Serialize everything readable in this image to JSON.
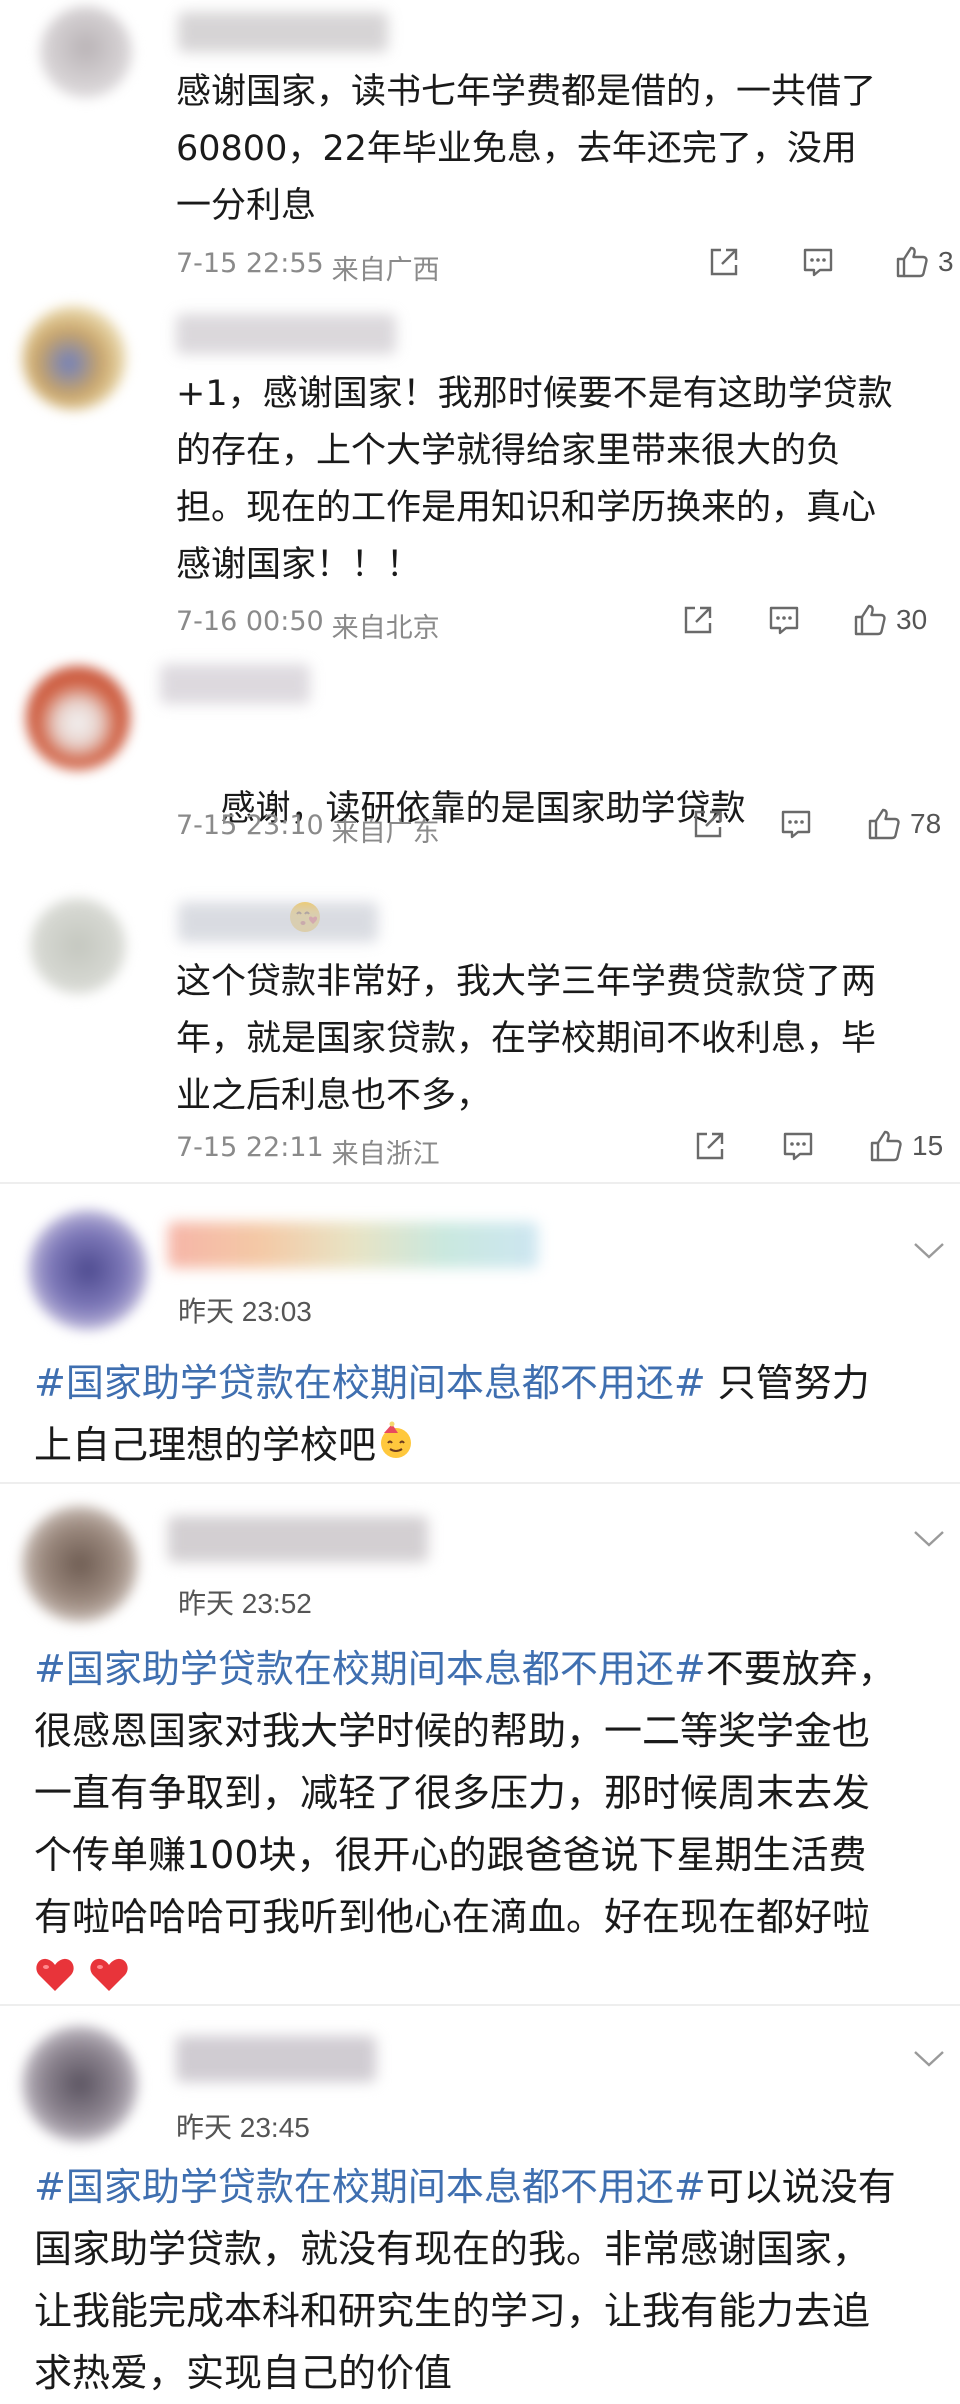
{
  "comments": [
    {
      "text": "感谢国家，读书七年学费都是借的，一共借了\n60800，22年毕业免息，去年还完了，没用\n一分利息",
      "date": "7-15 22:55",
      "location": "来自广西",
      "likes": "3"
    },
    {
      "text": "+1，感谢国家！我那时候要不是有这助学贷款\n的存在，上个大学就得给家里带来很大的负\n担。现在的工作是用知识和学历换来的，真心\n感谢国家！！！",
      "date": "7-16 00:50",
      "location": "来自北京",
      "likes": "30"
    },
    {
      "text": "感谢，读研依靠的是国家助学贷款",
      "date": "7-15 23:10",
      "location": "来自广东",
      "likes": "78",
      "emoji": "kiss-heart-emoji"
    },
    {
      "text": "这个贷款非常好，我大学三年学费贷款贷了两\n年，就是国家贷款，在学校期间不收利息，毕\n业之后利息也不多，",
      "date": "7-15 22:11",
      "location": "来自浙江",
      "likes": "15"
    }
  ],
  "posts": [
    {
      "time": "昨天 23:03",
      "hashtag": "#国家助学贷款在校期间本息都不用还#",
      "text1": " 只管努力",
      "text2": "上自己理想的学校吧",
      "emoji": "birthday-emoji"
    },
    {
      "time": "昨天 23:52",
      "hashtag": "#国家助学贷款在校期间本息都不用还#",
      "text1": "不要放弃，",
      "text2": "很感恩国家对我大学时候的帮助，一二等奖学金也\n一直有争取到，减轻了很多压力，那时候周末去发\n个传单赚100块，很开心的跟爸爸说下星期生活费\n有啦哈哈哈可我听到他心在滴血。好在现在都好啦",
      "emoji": "heart-emoji"
    },
    {
      "time": "昨天 23:45",
      "hashtag": "#国家助学贷款在校期间本息都不用还#",
      "text1": "可以说没有",
      "text2": "国家助学贷款，就没有现在的我。非常感谢国家，\n让我能完成本科和研究生的学习，让我有能力去追\n求热爱，实现自己的价值"
    }
  ],
  "colors": {
    "hashtag": "#3f6fb0",
    "meta_text": "#8a8a8a",
    "heart": "#e8343a"
  }
}
